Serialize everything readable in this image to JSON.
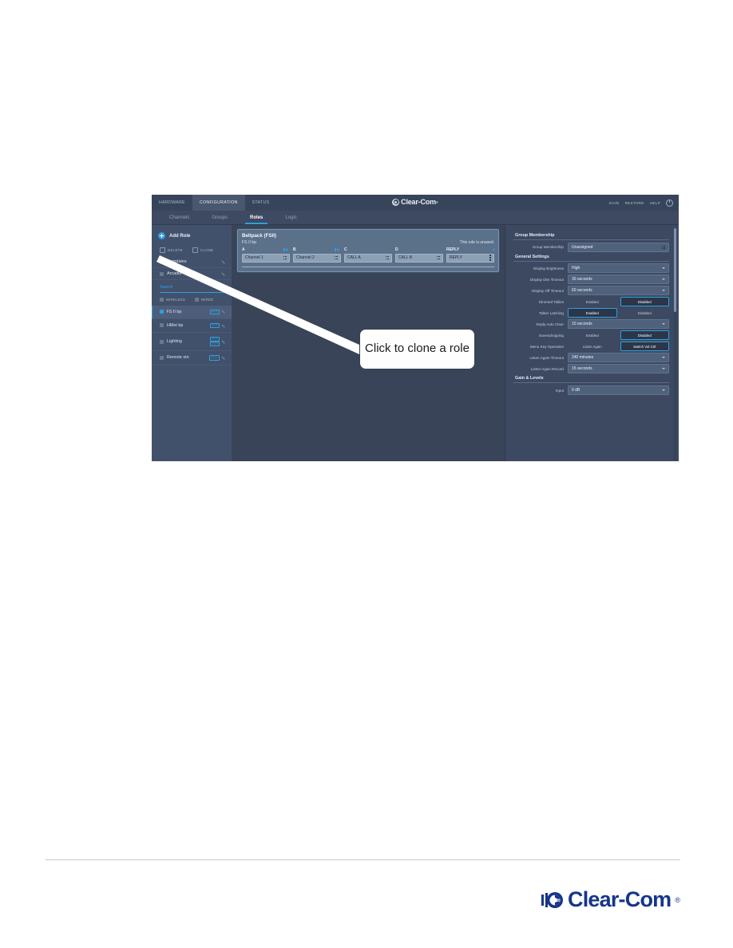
{
  "app": {
    "brand": {
      "name": "Clear-Com",
      "registered": "®"
    },
    "top_tabs": [
      {
        "label": "HARDWARE",
        "active": false
      },
      {
        "label": "CONFIGURATION",
        "active": true
      },
      {
        "label": "STATUS",
        "active": false
      }
    ],
    "header_actions": [
      {
        "label": "SAVE"
      },
      {
        "label": "RESTORE"
      },
      {
        "label": "HELP"
      }
    ],
    "power_icon": "power-icon",
    "sub_tabs": [
      {
        "label": "Channels",
        "active": false
      },
      {
        "label": "Groups",
        "active": false
      },
      {
        "label": "Roles",
        "active": true
      },
      {
        "label": "Logic",
        "active": false
      }
    ]
  },
  "sidebar": {
    "add_role": "Add Role",
    "actions": [
      {
        "label": "DELETE",
        "icon": "trash-icon"
      },
      {
        "label": "CLONE",
        "icon": "copy-icon"
      }
    ],
    "groups": [
      {
        "label": "Templates"
      },
      {
        "label": "Arcadia"
      }
    ],
    "search": {
      "placeholder": "Search",
      "value": "",
      "icon": "search-icon"
    },
    "filters": [
      {
        "label": "WIRELESS"
      },
      {
        "label": "WIRED"
      }
    ],
    "roles": [
      {
        "label": "FS II bp",
        "badge": "4CH",
        "selected": true,
        "stacked": false
      },
      {
        "label": "HMet bp",
        "badge": "4CH",
        "selected": false,
        "stacked": false
      },
      {
        "label": "Lighting",
        "badge": "4CH",
        "badge2": "4CH",
        "selected": false,
        "stacked": true
      },
      {
        "label": "Remote stn",
        "badge": "CCC",
        "selected": false,
        "stacked": false
      }
    ]
  },
  "beltpack": {
    "title": "Beltpack (FSII)",
    "role_name": "FS II bp",
    "status": "This role is unused.",
    "keys": [
      {
        "letter": "A",
        "value": "Channel 1",
        "has_icons": true
      },
      {
        "letter": "B",
        "value": "Channel 2",
        "has_icons": true
      },
      {
        "letter": "C",
        "value": "CALL A",
        "has_icons": false
      },
      {
        "letter": "D",
        "value": "CALL B",
        "has_icons": false
      },
      {
        "letter": "REPLY",
        "value": "REPLY",
        "has_icons": false
      }
    ]
  },
  "callout": {
    "text": "Click to clone a role"
  },
  "settings": {
    "sections": [
      {
        "title": "Group Membership",
        "rows": [
          {
            "label": "Group Membership",
            "type": "field",
            "value": "Unassigned"
          }
        ]
      },
      {
        "title": "General Settings",
        "rows": [
          {
            "label": "Display Brightness",
            "type": "select",
            "value": "High"
          },
          {
            "label": "Display Dim Timeout",
            "type": "select",
            "value": "30 seconds"
          },
          {
            "label": "Display Off Timeout",
            "type": "select",
            "value": "60 seconds"
          },
          {
            "label": "Dimmed Tallies",
            "type": "toggle",
            "options": [
              "Enabled",
              "Disabled"
            ],
            "selected": "Disabled"
          },
          {
            "label": "Talker Latching",
            "type": "toggle",
            "options": [
              "Enabled",
              "Disabled"
            ],
            "selected": "Enabled"
          },
          {
            "label": "Reply Auto Clear",
            "type": "select",
            "value": "10 seconds"
          },
          {
            "label": "Eavesdropping",
            "type": "toggle",
            "options": [
              "Enabled",
              "Disabled"
            ],
            "selected": "Disabled"
          },
          {
            "label": "Menu Key Operation",
            "type": "toggle",
            "options": [
              "Listen Again",
              "Switch Vol Ctrl"
            ],
            "selected": "Switch Vol Ctrl"
          },
          {
            "label": "Listen Again Timeout",
            "type": "select",
            "value": "240 minutes"
          },
          {
            "label": "Listen Again Record",
            "type": "select",
            "value": "15 seconds"
          }
        ]
      },
      {
        "title": "Gain & Levels",
        "rows": [
          {
            "label": "Input",
            "type": "select",
            "value": "0 dB"
          }
        ]
      }
    ]
  },
  "footer": {
    "logo_text": "Clear-Com",
    "logo_registered": "®"
  },
  "colors": {
    "accent": "#2e9fe0",
    "app_bg": "#394458",
    "sidebar_bg": "#42516b",
    "settings_bg": "#3c4961",
    "card_bg": "#5b7089",
    "brand_blue": "#15358c"
  }
}
